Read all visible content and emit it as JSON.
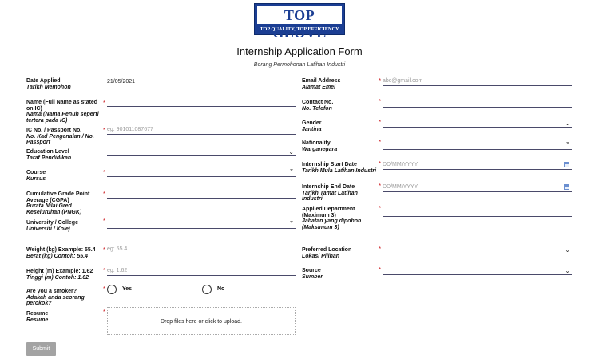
{
  "logo": {
    "name": "TOP GLOVE",
    "tagline": "TOP QUALITY, TOP EFFICIENCY"
  },
  "form": {
    "title": "Internship Application Form",
    "subtitle": "Borang Permohonan Latihan Industri"
  },
  "left_fields": {
    "date_applied": {
      "label": "Date Applied",
      "label_ms": "Tarikh Memohon",
      "value": "21/05/2021"
    },
    "name": {
      "label": "Name (Full Name as stated on IC)",
      "label_ms": "Nama (Nama Penuh seperti tertera pada IC)",
      "required": "*"
    },
    "ic": {
      "label": "IC No. / Passport No.",
      "label_ms": "No. Kad Pengenalan / No. Passport",
      "required": "*",
      "placeholder": "eg: 901011087677"
    },
    "education": {
      "label": "Education Level",
      "label_ms": "Taraf Pendidikan"
    },
    "course": {
      "label": "Course",
      "label_ms": "Kursus",
      "required": "*"
    },
    "cgpa": {
      "label": "Cumulative Grade Point Average (CGPA)",
      "label_ms": "Purata Nilai Gred Keseluruhan (PNGK)",
      "required": "*"
    },
    "university": {
      "label": "University / College",
      "label_ms": "Universiti / Kolej",
      "required": "*"
    },
    "weight": {
      "label": "Weight (kg) Example: 55.4",
      "label_ms": "Berat (kg) Contoh: 55.4",
      "required": "*",
      "placeholder": "eg: 55.4"
    },
    "height": {
      "label": "Height (m) Example: 1.62",
      "label_ms": "Tinggi (m) Contoh: 1.62",
      "required": "*",
      "placeholder": "eg: 1.62"
    },
    "smoker": {
      "label": "Are you a smoker?",
      "label_ms": "Adakah anda seorang perokok?",
      "required": "*",
      "yes": "Yes",
      "no": "No"
    },
    "resume": {
      "label": "Resume",
      "label_ms": "Resume",
      "required": "*",
      "drop_text": "Drop files here or click to upload."
    }
  },
  "right_fields": {
    "email": {
      "label": "Email Address",
      "label_ms": "Alamat Emel",
      "required": "*",
      "placeholder": "abc@gmail.com"
    },
    "contact": {
      "label": "Contact No.",
      "label_ms": "No. Telefon",
      "required": "*"
    },
    "gender": {
      "label": "Gender",
      "label_ms": "Jantina",
      "required": "*"
    },
    "nationality": {
      "label": "Nationality",
      "label_ms": "Warganegara",
      "required": "*"
    },
    "start_date": {
      "label": "Internship Start Date",
      "label_ms": "Tarikh Mula Latihan Industri",
      "required": "*",
      "placeholder": "DD/MM/YYYY"
    },
    "end_date": {
      "label": "Internship End Date",
      "label_ms": "Tarikh Tamat Latihan Industri",
      "required": "*",
      "placeholder": "DD/MM/YYYY"
    },
    "department": {
      "label": "Applied Department (Maximum 3)",
      "label_ms": "Jabatan yang dipohon (Maksimum 3)",
      "required": "*"
    },
    "location": {
      "label": "Preferred Location",
      "label_ms": "Lokasi Pilihan",
      "required": "*"
    },
    "source": {
      "label": "Source",
      "label_ms": "Sumber",
      "required": "*"
    }
  },
  "submit_label": "Submit",
  "icons": {
    "dropdown": "chevron-down-icon",
    "calendar": "calendar-icon"
  },
  "colors": {
    "brand": "#1b3e93",
    "required": "#d0262b",
    "submit": "#a3a3a3"
  }
}
